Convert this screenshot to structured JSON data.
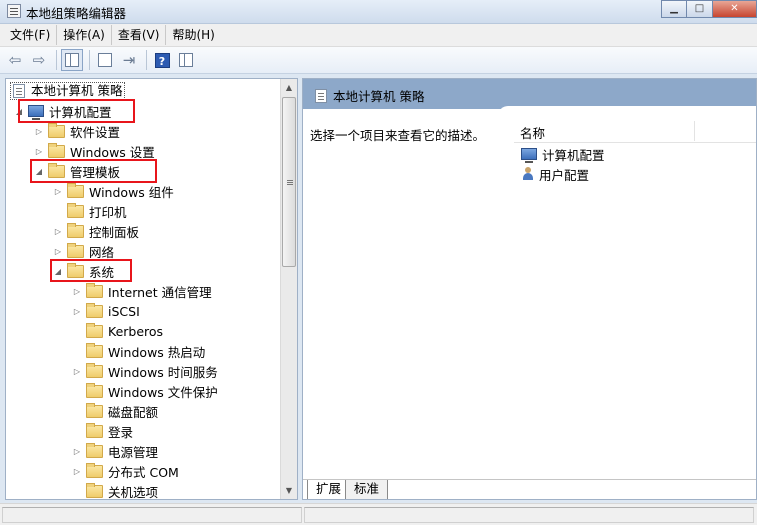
{
  "window": {
    "title": "本地组策略编辑器",
    "controls": [
      "minimize-icon",
      "maximize-icon",
      "close-icon"
    ]
  },
  "menu": {
    "items": [
      {
        "label": "文件(F)"
      },
      {
        "label": "操作(A)"
      },
      {
        "label": "查看(V)"
      },
      {
        "label": "帮助(H)"
      }
    ]
  },
  "toolbar": {
    "icons": [
      "back-arrow-icon",
      "forward-arrow-icon",
      "show-hide-tree-icon",
      "properties-icon",
      "export-list-icon",
      "help-icon",
      "details-view-icon"
    ]
  },
  "tree": {
    "root": "本地计算机 策略",
    "computer_config": "计算机配置",
    "software_settings": "软件设置",
    "windows_settings": "Windows 设置",
    "admin_templates": "管理模板",
    "windows_components": "Windows 组件",
    "printers": "打印机",
    "control_panel": "控制面板",
    "network": "网络",
    "system": "系统",
    "system_children": [
      {
        "label": "Internet 通信管理",
        "expandable": true
      },
      {
        "label": "iSCSI",
        "expandable": true
      },
      {
        "label": "Kerberos",
        "expandable": false
      },
      {
        "label": "Windows 热启动",
        "expandable": false
      },
      {
        "label": "Windows 时间服务",
        "expandable": true
      },
      {
        "label": "Windows 文件保护",
        "expandable": false
      },
      {
        "label": "磁盘配额",
        "expandable": false
      },
      {
        "label": "登录",
        "expandable": false
      },
      {
        "label": "电源管理",
        "expandable": true
      },
      {
        "label": "分布式 COM",
        "expandable": true
      },
      {
        "label": "关机选项",
        "expandable": false
      }
    ]
  },
  "details": {
    "header_title": "本地计算机 策略",
    "description": "选择一个项目来查看它的描述。",
    "column_name": "名称",
    "items": [
      {
        "label": "计算机配置",
        "icon": "computer-icon"
      },
      {
        "label": "用户配置",
        "icon": "user-icon"
      }
    ],
    "tabs": [
      {
        "label": "扩展"
      },
      {
        "label": "标准"
      }
    ]
  },
  "highlight_color": "#e8151b"
}
